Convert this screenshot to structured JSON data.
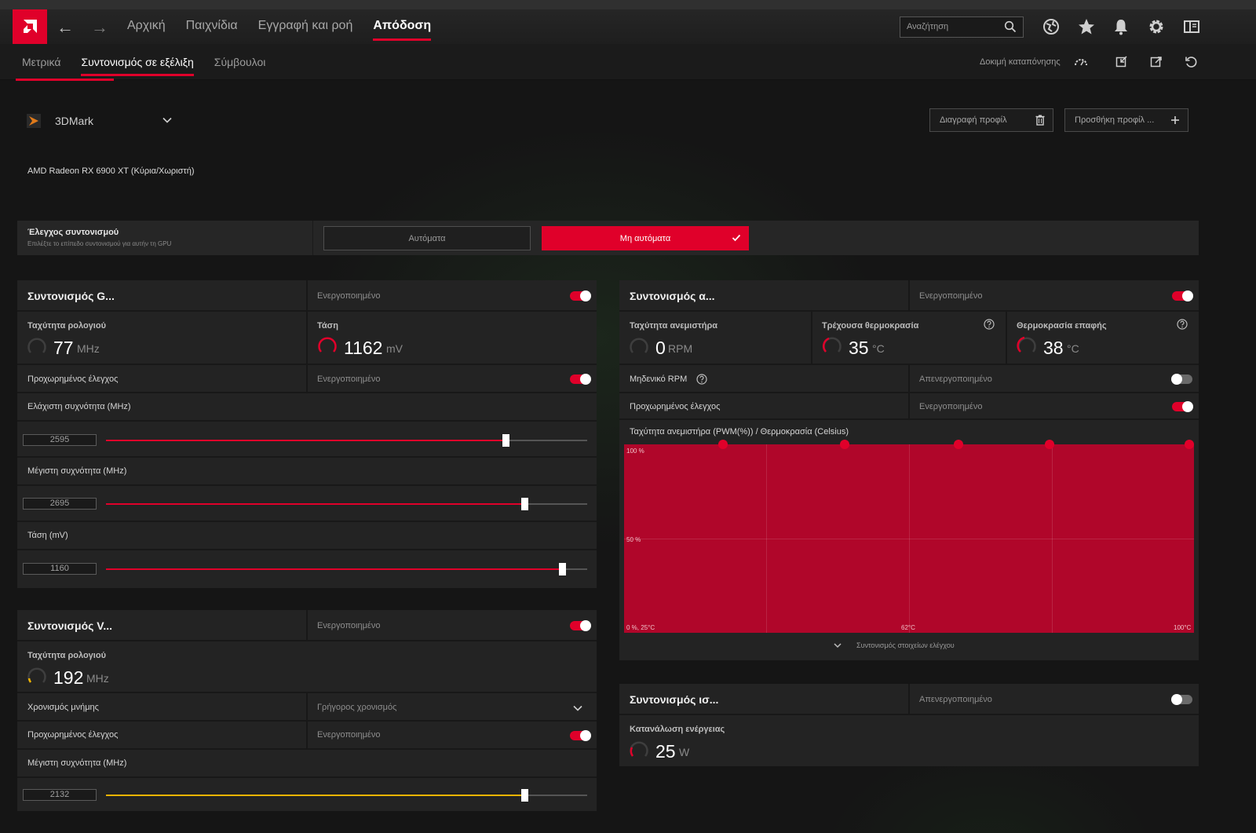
{
  "top_nav": {
    "items": [
      {
        "label": "Αρχική"
      },
      {
        "label": "Παιχνίδια"
      },
      {
        "label": "Εγγραφή και ροή"
      },
      {
        "label": "Απόδοση"
      }
    ],
    "active_index": 3,
    "search_placeholder": "Αναζήτηση"
  },
  "sub_nav": {
    "items": [
      {
        "label": "Μετρικά"
      },
      {
        "label": "Συντονισμός σε εξέλιξη"
      },
      {
        "label": "Σύμβουλοι"
      }
    ],
    "active_index": 1,
    "stress_test_label": "Δοκιμή καταπόνησης"
  },
  "profile": {
    "name": "3DMark",
    "delete_label": "Διαγραφή προφίλ",
    "add_label": "Προσθήκη προφίλ ..."
  },
  "gpu_name": "AMD Radeon RX 6900 XT (Κύρια/Χωριστή)",
  "tuning_control": {
    "title": "Έλεγχος συντονισμού",
    "description": "Επιλέξτε το επίπεδο συντονισμού για αυτήν τη GPU",
    "auto_label": "Αυτόματα",
    "manual_label": "Μη αυτόματα"
  },
  "gpu_tuning": {
    "title": "Συντονισμός G...",
    "status": "Ενεργοποιημένο",
    "clock_label": "Ταχύτητα ρολογιού",
    "clock_value": "77",
    "clock_unit": "MHz",
    "voltage_label": "Τάση",
    "voltage_value": "1162",
    "voltage_unit": "mV",
    "advanced_label": "Προχωρημένος έλεγχος",
    "advanced_status": "Ενεργοποιημένο",
    "sliders": [
      {
        "label": "Ελάχιστη συχνότητα (MHz)",
        "value": "2595",
        "fraction": 0.831
      },
      {
        "label": "Μέγιστη συχνότητα (MHz)",
        "value": "2695",
        "fraction": 0.869
      },
      {
        "label": "Τάση (mV)",
        "value": "1160",
        "fraction": 0.947
      }
    ]
  },
  "vram_tuning": {
    "title": "Συντονισμός V...",
    "status": "Ενεργοποιημένο",
    "clock_label": "Ταχύτητα ρολογιού",
    "clock_value": "192",
    "clock_unit": "MHz",
    "timing_label": "Χρονισμός μνήμης",
    "timing_value": "Γρήγορος χρονισμός",
    "advanced_label": "Προχωρημένος έλεγχος",
    "advanced_status": "Ενεργοποιημένο",
    "max_freq_label": "Μέγιστη συχνότητα (MHz)",
    "max_freq_value": "2132",
    "max_freq_fraction": 0.87
  },
  "fan_tuning": {
    "title": "Συντονισμός α...",
    "status": "Ενεργοποιημένο",
    "fan_speed_label": "Ταχύτητα ανεμιστήρα",
    "fan_speed_value": "0",
    "fan_speed_unit": "RPM",
    "current_temp_label": "Τρέχουσα θερμοκρασία",
    "current_temp_value": "35",
    "temp_unit": "°C",
    "junction_temp_label": "Θερμοκρασία επαφής",
    "junction_temp_value": "38",
    "zero_rpm_label": "Μηδενικό RPM",
    "zero_rpm_status": "Απενεργοποιημένο",
    "advanced_label": "Προχωρημένος έλεγχος",
    "advanced_status": "Ενεργοποιημένο",
    "curve_title": "Ταχύτητα ανεμιστήρα (PWM(%)) / Θερμοκρασία (Celsius)",
    "expand_label": "Συντονισμός στοιχείων ελέγχου"
  },
  "chart_data": {
    "type": "line",
    "title": "Ταχύτητα ανεμιστήρα (PWM(%)) / Θερμοκρασία (Celsius)",
    "y_tick_labels": [
      "100 %",
      "50 %"
    ],
    "x_tick_labels": [
      "0 %, 25°C",
      "62°C",
      "100°C"
    ],
    "xlim": [
      25,
      100
    ],
    "ylim": [
      0,
      100
    ],
    "x": [
      38,
      54,
      69,
      81,
      100
    ],
    "y": [
      100,
      100,
      100,
      100,
      100
    ]
  },
  "power_tuning": {
    "title": "Συντονισμός ισ...",
    "status": "Απενεργοποιημένο",
    "power_label": "Κατανάλωση ενέργειας",
    "power_value": "25",
    "power_unit": "W"
  },
  "colors": {
    "accent": "#e0002a",
    "vram_accent": "#f0b400",
    "chart_fill": "#b0062a"
  }
}
